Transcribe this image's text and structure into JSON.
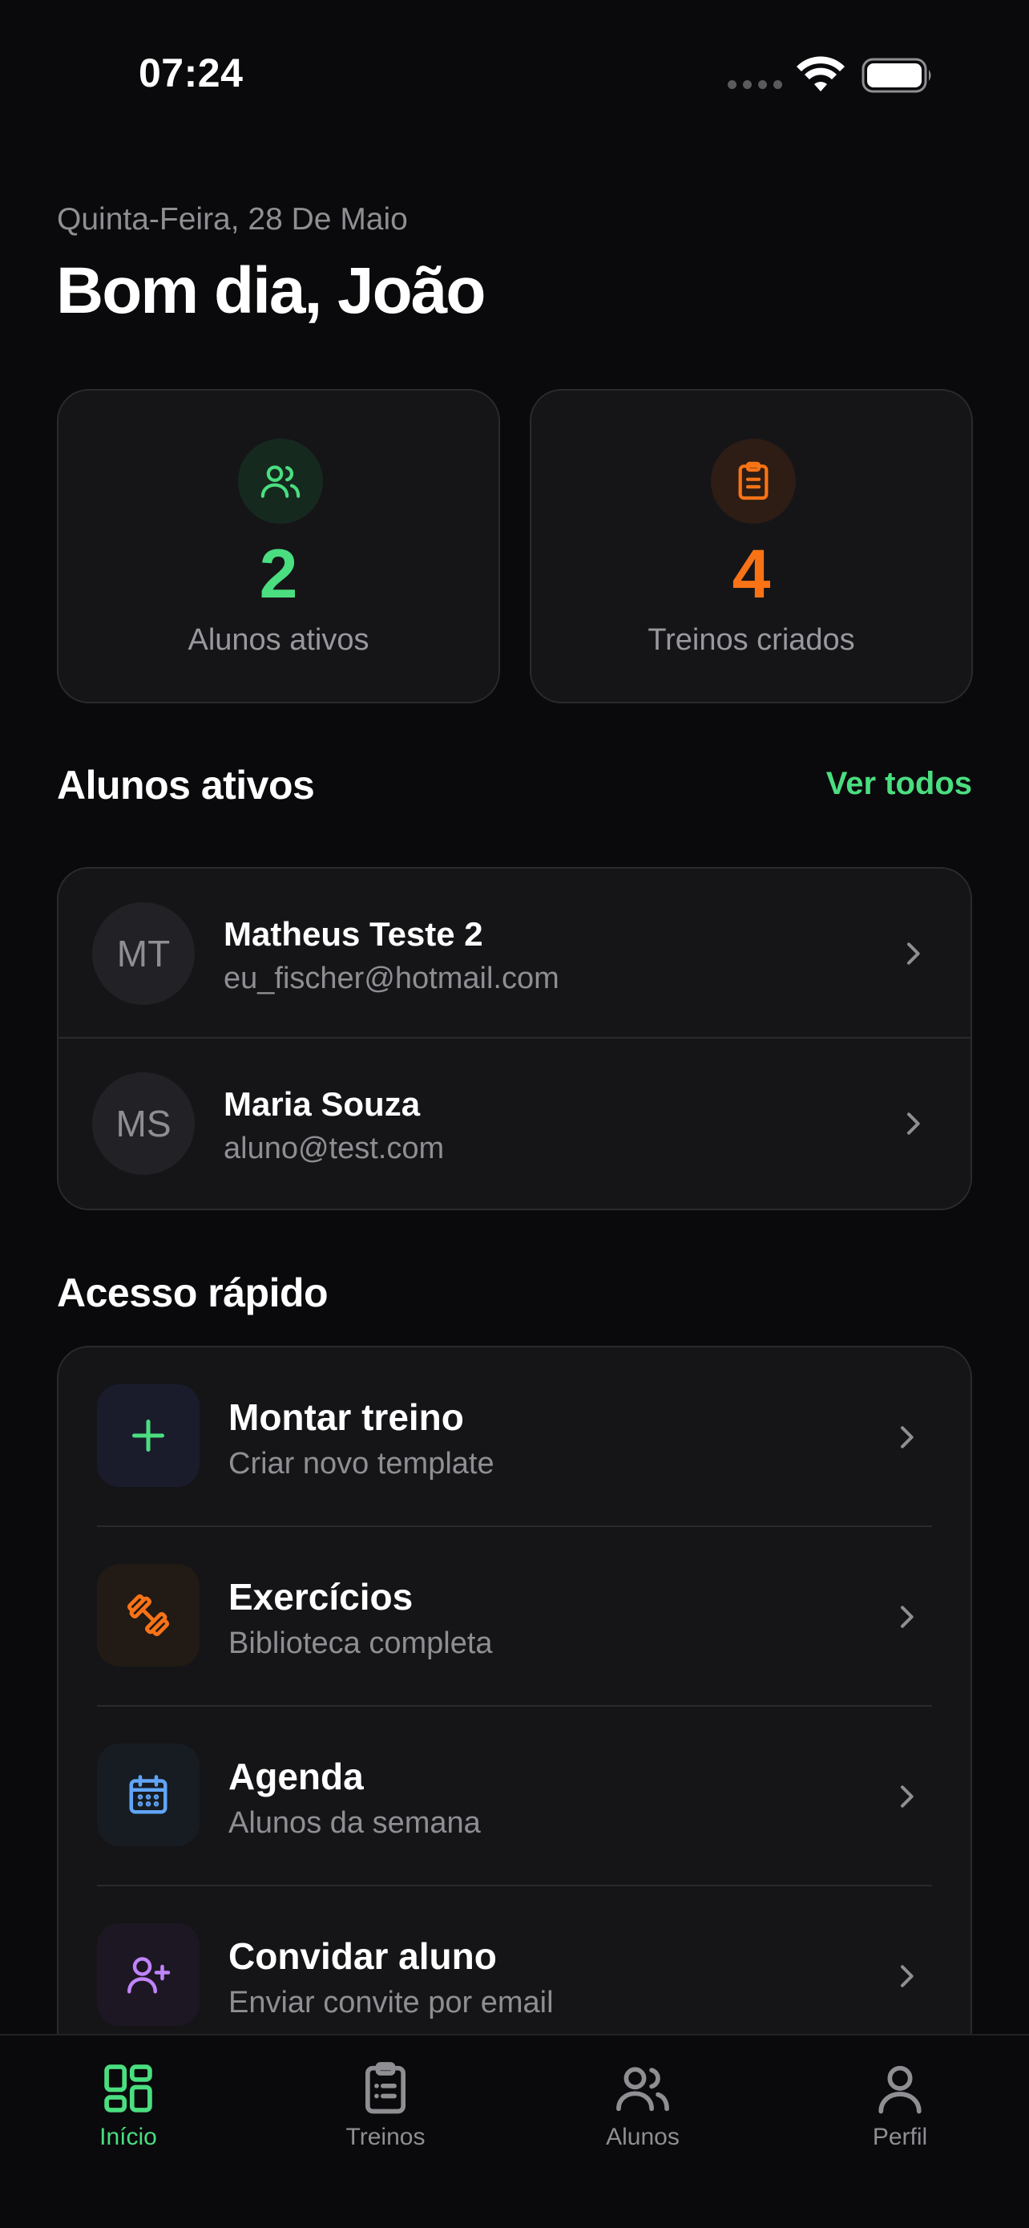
{
  "status_bar": {
    "time": "07:24"
  },
  "header": {
    "date": "Quinta-Feira, 28 De Maio",
    "greeting": "Bom dia, João"
  },
  "stats": [
    {
      "value": "2",
      "label": "Alunos ativos",
      "icon": "users-icon",
      "color": "#4ade80"
    },
    {
      "value": "4",
      "label": "Treinos criados",
      "icon": "clipboard-icon",
      "color": "#f97316"
    }
  ],
  "active_students": {
    "title": "Alunos ativos",
    "see_all": "Ver todos",
    "items": [
      {
        "initials": "MT",
        "name": "Matheus Teste 2",
        "email": "eu_fischer@hotmail.com"
      },
      {
        "initials": "MS",
        "name": "Maria Souza",
        "email": "aluno@test.com"
      }
    ]
  },
  "quick_access": {
    "title": "Acesso rápido",
    "items": [
      {
        "title": "Montar treino",
        "subtitle": "Criar novo template",
        "icon": "plus-icon",
        "color": "#4ade80"
      },
      {
        "title": "Exercícios",
        "subtitle": "Biblioteca completa",
        "icon": "dumbbell-icon",
        "color": "#f97316"
      },
      {
        "title": "Agenda",
        "subtitle": "Alunos da semana",
        "icon": "calendar-icon",
        "color": "#60a5fa"
      },
      {
        "title": "Convidar aluno",
        "subtitle": "Enviar convite por email",
        "icon": "user-plus-icon",
        "color": "#c084fc"
      }
    ]
  },
  "tab_bar": {
    "active_color": "#4ade80",
    "items": [
      {
        "label": "Início",
        "icon": "grid-icon",
        "active": true
      },
      {
        "label": "Treinos",
        "icon": "clipboard-icon",
        "active": false
      },
      {
        "label": "Alunos",
        "icon": "users-icon",
        "active": false
      },
      {
        "label": "Perfil",
        "icon": "user-icon",
        "active": false
      }
    ]
  }
}
